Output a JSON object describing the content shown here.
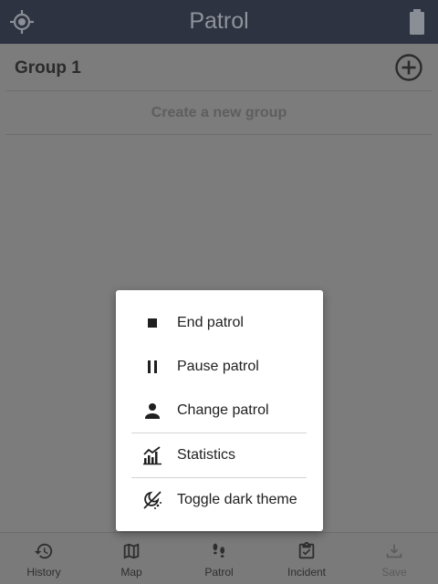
{
  "appbar": {
    "title": "Patrol",
    "left_icon": "gps-location-icon",
    "right_icon": "battery-icon"
  },
  "content": {
    "group_title": "Group 1",
    "add_icon": "add-circle-icon",
    "create_group_label": "Create a new group"
  },
  "menu": {
    "items": [
      {
        "label": "End patrol",
        "icon": "stop-icon"
      },
      {
        "label": "Pause patrol",
        "icon": "pause-icon"
      },
      {
        "label": "Change patrol",
        "icon": "person-icon"
      },
      {
        "label": "Statistics",
        "icon": "statistics-icon"
      },
      {
        "label": "Toggle dark theme",
        "icon": "dark-theme-icon"
      }
    ]
  },
  "bottomnav": {
    "items": [
      {
        "label": "History",
        "icon": "history-icon"
      },
      {
        "label": "Map",
        "icon": "map-icon"
      },
      {
        "label": "Patrol",
        "icon": "footsteps-icon"
      },
      {
        "label": "Incident",
        "icon": "clipboard-check-icon"
      },
      {
        "label": "Save",
        "icon": "download-icon",
        "disabled": true
      }
    ]
  },
  "colors": {
    "appbar_bg": "#2d3340",
    "scrim_bg": "#7c7c7c",
    "menu_bg": "#ffffff",
    "text_primary": "#212121"
  }
}
